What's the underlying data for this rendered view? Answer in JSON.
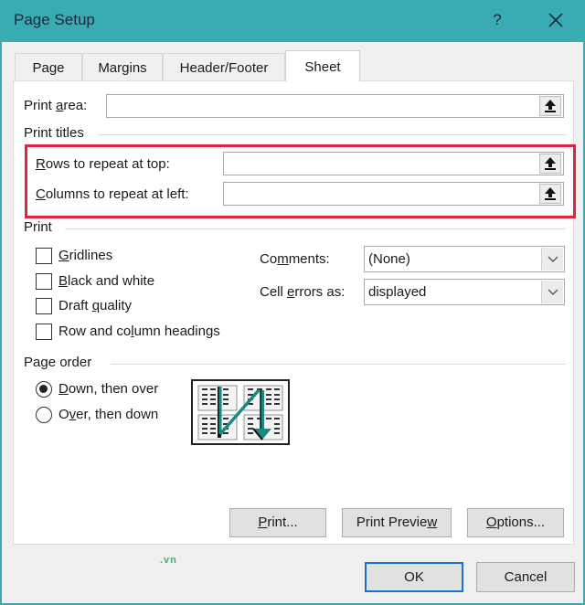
{
  "window": {
    "title": "Page Setup",
    "help_label": "?",
    "close_label": "✕"
  },
  "tabs": [
    {
      "label": "Page",
      "active": false
    },
    {
      "label": "Margins",
      "active": false
    },
    {
      "label": "Header/Footer",
      "active": false
    },
    {
      "label": "Sheet",
      "active": true
    }
  ],
  "sheet": {
    "print_area": {
      "label_pre": "Print ",
      "label_u": "a",
      "label_post": "rea:",
      "value": ""
    },
    "print_titles": {
      "heading": "Print titles",
      "rows_repeat": {
        "label_u": "R",
        "label_post": "ows to repeat at top:",
        "value": ""
      },
      "cols_repeat": {
        "label_u": "C",
        "label_post": "olumns to repeat at left:",
        "value": ""
      }
    },
    "print": {
      "heading": "Print",
      "checkboxes": [
        {
          "label_pre": "",
          "label_u": "G",
          "label_post": "ridlines",
          "checked": false
        },
        {
          "label_pre": "",
          "label_u": "B",
          "label_post": "lack and white",
          "checked": false
        },
        {
          "label_pre": "Draft ",
          "label_u": "q",
          "label_post": "uality",
          "checked": false
        },
        {
          "label_pre": "Row and co",
          "label_u": "l",
          "label_post": "umn headings",
          "checked": false
        }
      ],
      "comments": {
        "label_pre": "Co",
        "label_u": "m",
        "label_post": "ments:",
        "value": "(None)"
      },
      "cell_errors": {
        "label_pre": "Cell ",
        "label_u": "e",
        "label_post": "rrors as:",
        "value": "displayed"
      }
    },
    "page_order": {
      "heading": "Page order",
      "options": [
        {
          "label_u": "D",
          "label_post": "own, then over",
          "selected": true
        },
        {
          "label_pre": "O",
          "label_u": "v",
          "label_post": "er, then down",
          "selected": false
        }
      ]
    },
    "buttons": {
      "print": {
        "label_u": "P",
        "label_post": "rint..."
      },
      "print_preview": {
        "label_pre": "Print Previe",
        "label_u": "w"
      },
      "options": {
        "label_u": "O",
        "label_post": "ptions..."
      }
    }
  },
  "footer": {
    "ok_label": "OK",
    "cancel_label": "Cancel"
  },
  "watermark": ".vn",
  "colors": {
    "titlebar": "#39abb3",
    "highlight": "#e0243b",
    "default_button_border": "#1f6fcf",
    "arrow_teal": "#1a8a80"
  }
}
